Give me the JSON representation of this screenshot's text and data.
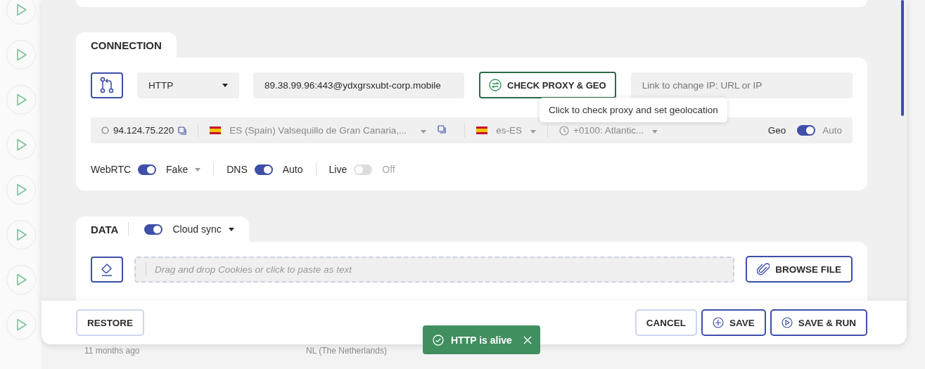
{
  "connection": {
    "title": "CONNECTION",
    "proxy_type": "HTTP",
    "proxy_address": "89.38.99.96:443@ydxgrsxubt-corp.mobile",
    "check_button": "CHECK PROXY & GEO",
    "change_ip_placeholder": "Link to change IP: URL or IP",
    "tooltip": "Click to check proxy and set geolocation",
    "ip": "94.124.75.220",
    "location": "ES (Spain) Valsequillo de Gran Canaria,...",
    "language": "es-ES",
    "timezone": "+0100: Atlantic...",
    "geo": {
      "label": "Geo",
      "on": true,
      "value": "Auto"
    },
    "toggles": [
      {
        "label": "WebRTC",
        "on": true,
        "value": "Fake",
        "dropdown": true
      },
      {
        "label": "DNS",
        "on": true,
        "value": "Auto",
        "dropdown": false
      },
      {
        "label": "Live",
        "on": false,
        "value": "Off",
        "dropdown": false
      }
    ]
  },
  "data": {
    "title": "DATA",
    "cloud_sync": {
      "label": "Cloud sync",
      "on": true
    },
    "cookies_placeholder": "Drag and drop Cookies or click to paste as text",
    "browse_button": "BROWSE FILE"
  },
  "footer": {
    "restore": "RESTORE",
    "cancel": "CANCEL",
    "save": "SAVE",
    "save_run": "SAVE & RUN"
  },
  "toast": {
    "message": "HTTP is alive"
  },
  "background": {
    "texts": [
      "11 months ago",
      "NL (The Netherlands)"
    ]
  }
}
